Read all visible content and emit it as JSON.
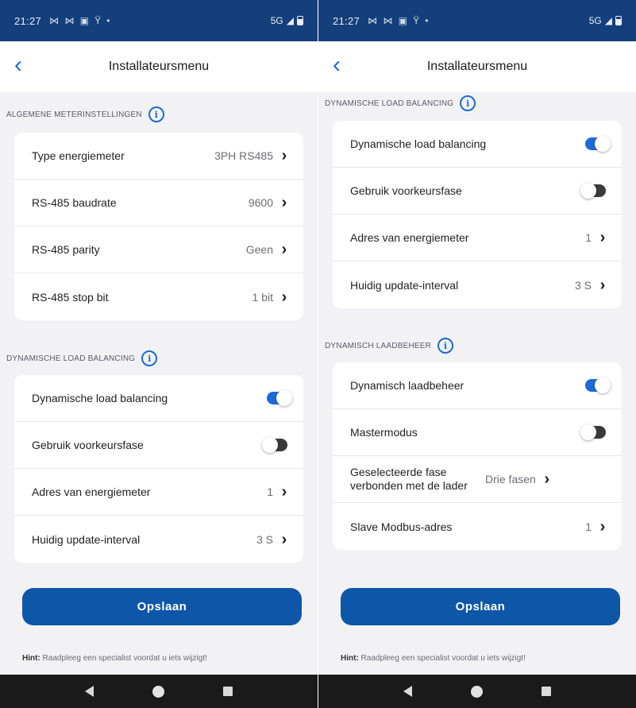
{
  "left": {
    "status": {
      "time": "21:27",
      "icons": "⋈ ⋈ ▣ Ϋ •",
      "network": "5G"
    },
    "appbar": {
      "title": "Installateursmenu"
    },
    "sections": [
      {
        "title": "ALGEMENE METERINSTELLINGEN",
        "rows": [
          {
            "label": "Type energiemeter",
            "value": "3PH RS485"
          },
          {
            "label": "RS-485 baudrate",
            "value": "9600"
          },
          {
            "label": "RS-485 parity",
            "value": "Geen"
          },
          {
            "label": "RS-485 stop bit",
            "value": "1 bit"
          }
        ]
      },
      {
        "title": "DYNAMISCHE LOAD BALANCING",
        "rows": [
          {
            "label": "Dynamische load balancing",
            "toggle": true
          },
          {
            "label": "Gebruik voorkeursfase",
            "toggle": false
          },
          {
            "label": "Adres van energiemeter",
            "value": "1"
          },
          {
            "label": "Huidig update-interval",
            "value": "3 S"
          }
        ]
      }
    ],
    "save_label": "Opslaan",
    "hint_bold": "Hint:",
    "hint_text": " Raadpleeg een specialist voordat u iets wijzigt!"
  },
  "right": {
    "status": {
      "time": "21:27",
      "icons": "⋈ ⋈ ▣ Ϋ •",
      "network": "5G"
    },
    "appbar": {
      "title": "Installateursmenu"
    },
    "sections": [
      {
        "title": "DYNAMISCHE LOAD BALANCING",
        "rows": [
          {
            "label": "Dynamische load balancing",
            "toggle": true
          },
          {
            "label": "Gebruik voorkeursfase",
            "toggle": false
          },
          {
            "label": "Adres van energiemeter",
            "value": "1"
          },
          {
            "label": "Huidig update-interval",
            "value": "3 S"
          }
        ]
      },
      {
        "title": "DYNAMISCH LAADBEHEER",
        "rows": [
          {
            "label": "Dynamisch laadbeheer",
            "toggle": true
          },
          {
            "label": "Mastermodus",
            "toggle": false
          },
          {
            "label": "Geselecteerde fase verbonden met de lader",
            "value": "Drie fasen"
          },
          {
            "label": "Slave Modbus-adres",
            "value": "1"
          }
        ]
      }
    ],
    "save_label": "Opslaan",
    "hint_bold": "Hint:",
    "hint_text": " Raadpleeg een specialist voordat u iets wijzigt!"
  },
  "colors": {
    "status_bar": "#143f7a",
    "accent": "#1e6ad6",
    "save_button": "#0e56a8",
    "nav_bar": "#1a1a1a"
  },
  "icons": {
    "back": "chevron-left-icon",
    "info": "info-icon",
    "row": "chevron-right-icon",
    "nav": [
      "nav-back-icon",
      "nav-home-icon",
      "nav-recent-icon"
    ]
  }
}
